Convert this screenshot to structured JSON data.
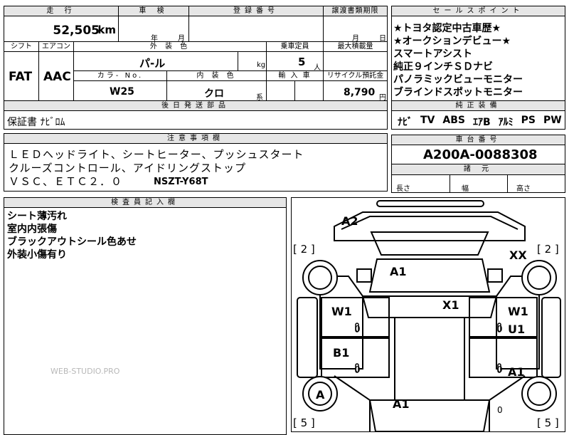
{
  "sheet": {
    "mileage": {
      "label": "走 行",
      "value": "52,505",
      "unit": "km"
    },
    "inspection": {
      "label": "車 検",
      "year_unit": "年",
      "month_unit": "月"
    },
    "registration": {
      "label": "登録番号"
    },
    "transfer_deadline": {
      "label": "譲渡書類期限",
      "month_unit": "月",
      "day_unit": "日"
    },
    "shift": {
      "label": "シフト",
      "value": "FAT"
    },
    "aircon": {
      "label": "エアコン",
      "value": "AAC"
    },
    "exterior_color": {
      "label": "外 装 色",
      "value": "パ-ル"
    },
    "kg_unit": "kg",
    "capacity": {
      "label": "乗車定員",
      "value": "5",
      "unit": "人"
    },
    "max_load": {
      "label": "最大積載量"
    },
    "color_no": {
      "label": "カラ- No.",
      "value": "W25"
    },
    "interior_color": {
      "label": "内 装 色",
      "value": "クロ",
      "suffix": "系"
    },
    "import": {
      "label": "輸 入 車"
    },
    "recycle": {
      "label": "リサイクル預託金",
      "value": "8,790",
      "unit": "円"
    },
    "later_parts": {
      "label": "後日発送部品",
      "value": "保証書 ﾅﾋﾞﾛﾑ"
    },
    "notes": {
      "label": "注意事項欄",
      "lines": [
        "ＬＥＤヘッドライト、シートヒーター、プッシュスタート",
        "クルーズコントロール、アイドリングストップ"
      ],
      "line3": "ＶＳＣ、ＥＴＣ２．０",
      "model": "NSZT-Y68T"
    },
    "selling_points": {
      "label": "セールスポイント",
      "items": [
        "★トヨタ認定中古車歴★",
        "★オークションデビュー★",
        "スマートアシスト",
        "純正９インチＳＤナビ",
        "パノラミックビューモニター",
        "ブラインドスポットモニター"
      ]
    },
    "factory_equipment": {
      "label": "純正装備",
      "items": [
        "ﾅﾋﾞ",
        "TV",
        "ABS",
        "ｴｱB",
        "ｱﾙﾐ",
        "PS",
        "PW"
      ]
    },
    "chassis": {
      "label": "車台番号",
      "value": "A200A-0088308"
    },
    "dimensions": {
      "label": "諸 元",
      "length": "長さ",
      "width": "幅",
      "height": "高さ"
    },
    "inspector": {
      "label": "検査員記入欄",
      "lines": [
        "シート薄汚れ",
        "室内内張傷",
        "ブラックアウトシール色あせ",
        "外装小傷有り"
      ]
    },
    "watermark": "WEB-STUDIO.PRO",
    "diagram": {
      "marks": [
        "A2",
        "A1",
        "XX",
        "X1",
        "W1",
        "W1",
        "U1",
        "B1",
        "A1",
        "A",
        "A1"
      ],
      "tires": [
        "[ 2 ]",
        "[ 2 ]",
        "[ 5 ]",
        "[ 5 ]"
      ],
      "zeros": [
        "0",
        "0",
        "0",
        "0",
        "0"
      ]
    }
  }
}
